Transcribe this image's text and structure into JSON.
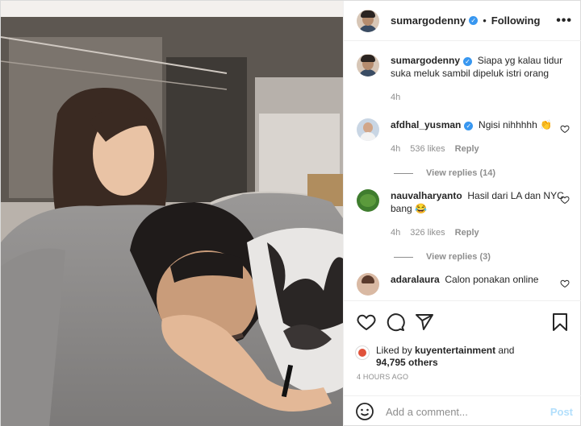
{
  "post": {
    "author": "sumargodenny",
    "follow_status": "Following",
    "separator": "•",
    "more_label": "•••"
  },
  "caption": {
    "username": "sumargodenny",
    "text": "Siapa yg kalau tidur suka meluk sambil dipeluk istri orang",
    "time": "4h"
  },
  "comments": [
    {
      "username": "afdhal_yusman",
      "text": "Ngisi nihhhhh 👏",
      "time": "4h",
      "likes": "536 likes",
      "reply_label": "Reply",
      "view_replies": "View replies (14)"
    },
    {
      "username": "nauvalharyanto",
      "text": "Hasil dari LA dan NYC bang 😂",
      "time": "4h",
      "likes": "326 likes",
      "reply_label": "Reply",
      "view_replies": "View replies (3)"
    },
    {
      "username": "adaralaura",
      "text": "Calon ponakan online"
    }
  ],
  "likes_summary": {
    "prefix": "Liked by",
    "user": "kuyentertainment",
    "and": "and",
    "others": "94,795 others"
  },
  "timestamp": "4 HOURS AGO",
  "add_comment": {
    "placeholder": "Add a comment...",
    "post_label": "Post"
  },
  "colors": {
    "verified": "#3897f0",
    "post_button_disabled": "#b2dffc",
    "meta_text": "#8e8e8e"
  },
  "icons": [
    "heart-icon",
    "comment-icon",
    "share-icon",
    "bookmark-icon",
    "smile-icon",
    "verified-icon",
    "more-icon"
  ]
}
